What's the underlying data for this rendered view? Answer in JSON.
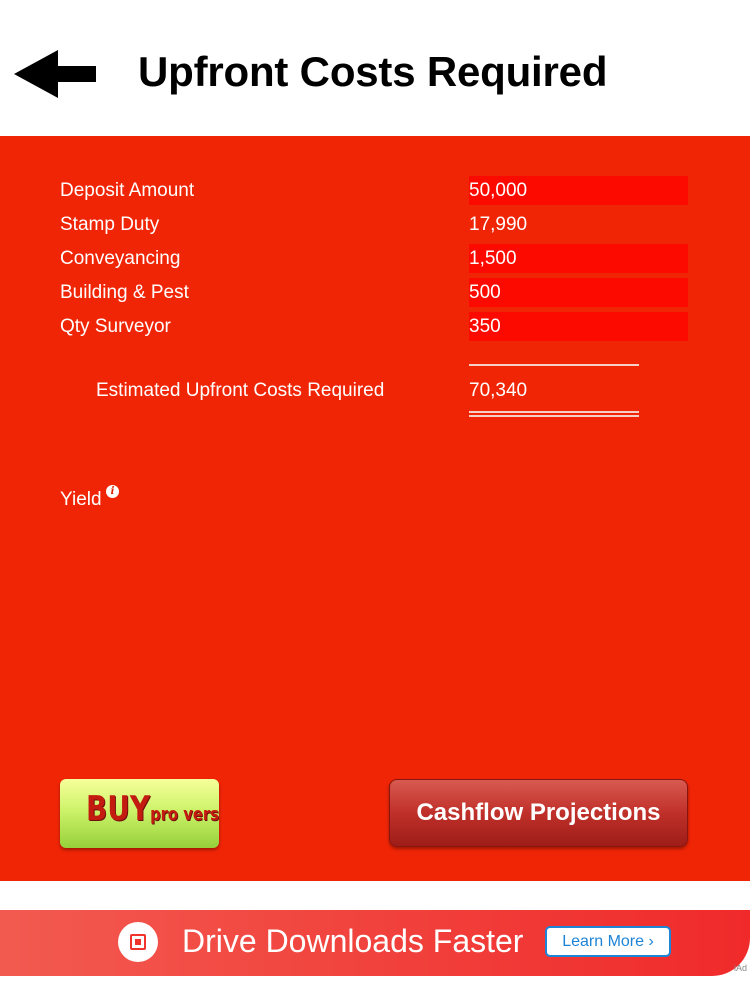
{
  "header": {
    "title": "Upfront Costs Required",
    "back_icon": "left-arrow-icon"
  },
  "costs": {
    "rows": [
      {
        "label": "Deposit Amount",
        "value": "50,000",
        "editable": true
      },
      {
        "label": "Stamp Duty",
        "value": "17,990",
        "editable": false
      },
      {
        "label": "Conveyancing",
        "value": "1,500",
        "editable": true
      },
      {
        "label": "Building & Pest",
        "value": "500",
        "editable": true
      },
      {
        "label": "Qty Surveyor",
        "value": "350",
        "editable": true
      }
    ],
    "total_label": "Estimated Upfront Costs Required",
    "total_value": "70,340"
  },
  "yield": {
    "label": "Yield",
    "info_icon": "info-icon"
  },
  "buttons": {
    "buy_main": "BUY",
    "buy_sub": "pro version",
    "cashflow": "Cashflow Projections"
  },
  "ad": {
    "text": "Drive Downloads Faster",
    "learn_more": "Learn More ›",
    "iad": "iAd"
  },
  "colors": {
    "main_bg": "#f02506",
    "field_bg": "#fc0a00",
    "buy_green": "#cdf36a",
    "cashflow_red": "#c0302a",
    "ad_red": "#f02a2a",
    "learn_blue": "#1e84d6"
  }
}
